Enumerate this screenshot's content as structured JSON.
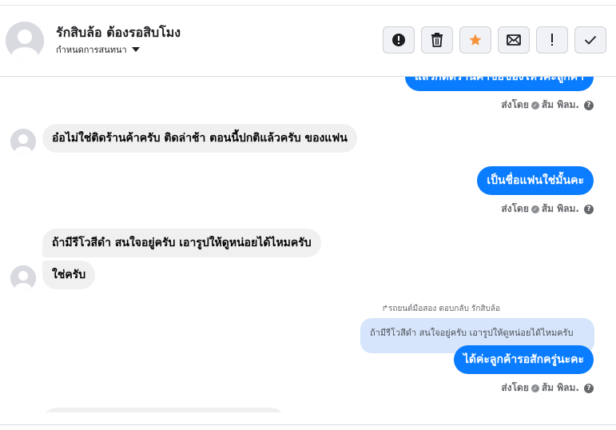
{
  "header": {
    "contact_name": "รักสิบล้อ ต้องรอสิบโมง",
    "assign_label": "กำหนดการสนทนา",
    "toolbar": [
      {
        "name": "alert-button",
        "icon": "alert-circle-icon",
        "glyph": "❗"
      },
      {
        "name": "delete-button",
        "icon": "trash-icon",
        "glyph": "🗑"
      },
      {
        "name": "star-button",
        "icon": "star-icon",
        "glyph": "★"
      },
      {
        "name": "mark-unread-button",
        "icon": "envelope-icon",
        "glyph": "✉"
      },
      {
        "name": "spam-button",
        "icon": "exclamation-icon",
        "glyph": "!"
      },
      {
        "name": "done-button",
        "icon": "check-icon",
        "glyph": "✓"
      }
    ]
  },
  "messages": {
    "m0_text": "แล้วก็ติดร้านค้าขยของไหวคะลูกค้า",
    "sent_by_1": "ส่งโดย",
    "sender_name_1": "ส้ม พิลม.",
    "m1_text": "อ๋อไม่ใช่ติดร้านค้าครับ ติดล่าช้า ตอนนี้ปกติแล้วครับ ของแฟน",
    "m2_text": "เป็นชื่อแฟนใช่มั้นคะ",
    "sent_by_2": "ส่งโดย",
    "sender_name_2": "ส้ม พิลม.",
    "m3_text": "ถ้ามีรีโวสีดำ สนใจอยู่ครับ เอารูปให้ดูหน่อยได้ไหมครับ",
    "m4_text": "ใช่ครับ",
    "reply_note": "↱รถยนต์มือสอง ตอบกลับ รักสิบล้อ",
    "quoted_text": "ถ้ามีรีโวสีดำ สนใจอยู่ครับ เอารูปให้ดูหน่อยได้ไหมครับ",
    "m5_text": "ได้ค่ะลูกค้ารอสักครู่นะคะ",
    "sent_by_3": "ส่งโดย",
    "sender_name_3": "ส้ม พิลม."
  },
  "colors": {
    "outgoing": "#0a7cff",
    "incoming": "#f0f0f0",
    "star": "#f7923a",
    "quote": "#d6e5fb"
  }
}
